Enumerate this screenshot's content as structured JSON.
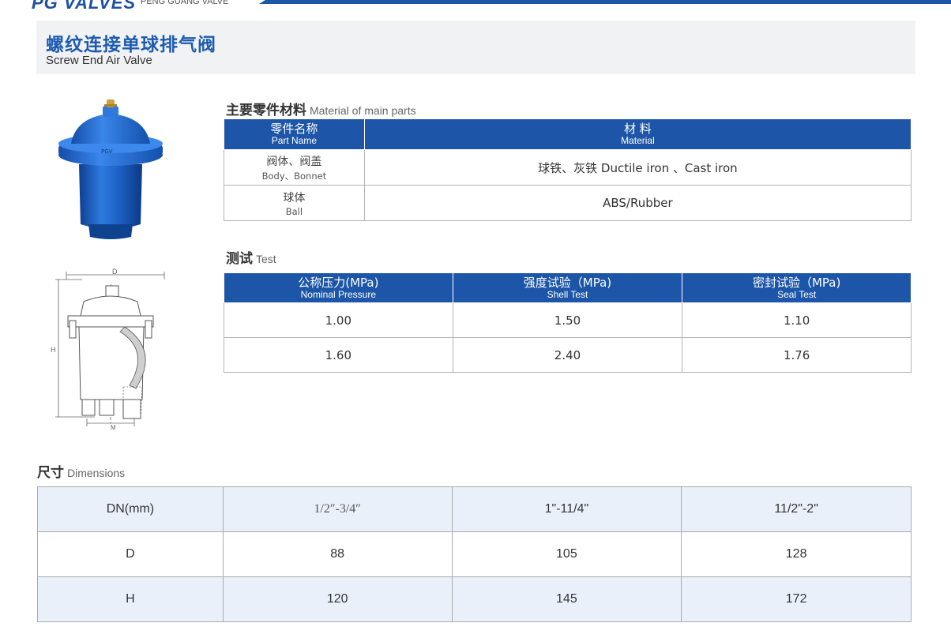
{
  "header": {
    "brand": "PG VALVES",
    "brand_sub": "PENG GUANG VALVE"
  },
  "title": {
    "zh": "螺纹连接单球排气阀",
    "en": "Screw End Air Valve"
  },
  "drawing_labels": {
    "d": "D",
    "h": "H",
    "m": "M"
  },
  "materials": {
    "heading_zh": "主要零件材料",
    "heading_en": "Material of main parts",
    "columns": [
      {
        "zh": "零件名称",
        "en": "Part Name"
      },
      {
        "zh": "材 料",
        "en": "Material"
      }
    ],
    "rows": [
      {
        "part_zh": "阀体、阀盖",
        "part_en": "Body、Bonnet",
        "material": "球铁、灰铁 Ductile iron 、Cast iron"
      },
      {
        "part_zh": "球体",
        "part_en": "Ball",
        "material": "ABS/Rubber"
      }
    ]
  },
  "test": {
    "heading_zh": "测试",
    "heading_en": "Test",
    "columns": [
      {
        "zh": "公称压力(MPa)",
        "en": "Nominal Pressure"
      },
      {
        "zh": "强度试验（MPa)",
        "en": "Shell Test"
      },
      {
        "zh": "密封试验（MPa)",
        "en": "Seal Test"
      }
    ],
    "rows": [
      [
        "1.00",
        "1.50",
        "1.10"
      ],
      [
        "1.60",
        "2.40",
        "1.76"
      ]
    ]
  },
  "dimensions": {
    "heading_zh": "尺寸",
    "heading_en": "Dimensions",
    "rows": [
      [
        "DN(mm)",
        "1/2″-3/4″",
        "1\"-11/4\"",
        "11/2\"-2\""
      ],
      [
        "D",
        "88",
        "105",
        "128"
      ],
      [
        "H",
        "120",
        "145",
        "172"
      ]
    ]
  },
  "colors": {
    "brand_blue": "#1d56a8",
    "valve_blue": "#1e63c8",
    "band_gray": "#f1f2f4",
    "row_shade": "#eaf0fa"
  }
}
